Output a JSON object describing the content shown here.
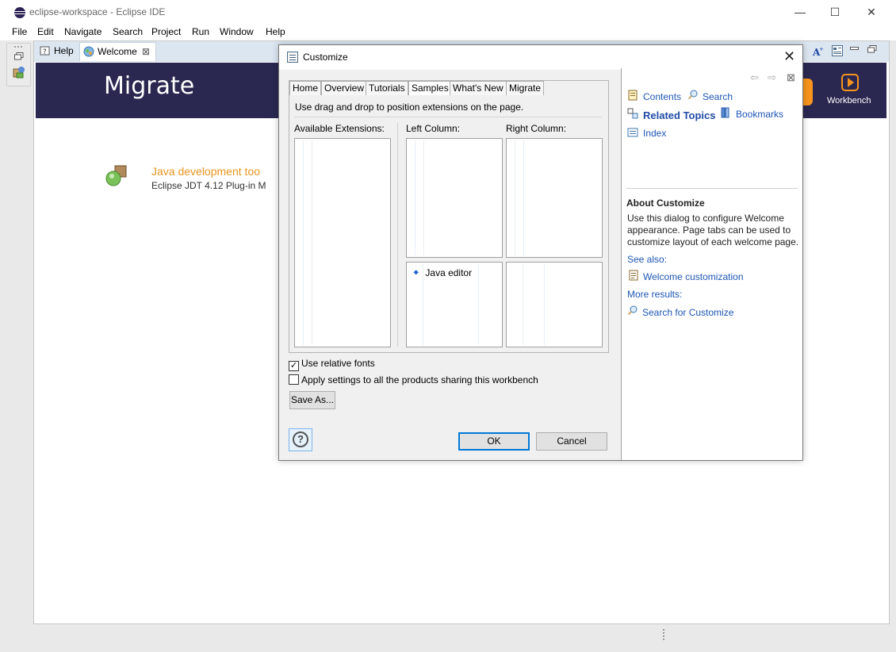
{
  "window": {
    "title": "eclipse-workspace - Eclipse IDE",
    "controls": {
      "minimize": "—",
      "maximize": "☐",
      "close": "✕"
    }
  },
  "menu": [
    "File",
    "Edit",
    "Navigate",
    "Search",
    "Project",
    "Run",
    "Window",
    "Help"
  ],
  "editor_tabs": [
    {
      "label": "Help",
      "icon": "help-icon"
    },
    {
      "label": "Welcome",
      "icon": "welcome-icon",
      "close": "⊠"
    }
  ],
  "welcome": {
    "banner_title": "Migrate",
    "workbench_label": "Workbench",
    "item_title": "Java development too",
    "item_desc": "Eclipse JDT 4.12 Plug-in M"
  },
  "dialog": {
    "title": "Customize",
    "close": "✕",
    "tabs": [
      "Home",
      "Overview",
      "Tutorials",
      "Samples",
      "What's New",
      "Migrate"
    ],
    "active_tab": "Samples",
    "hint": "Use drag and drop to position extensions on the page.",
    "columns": {
      "available": "Available Extensions:",
      "left": "Left Column:",
      "right": "Right Column:"
    },
    "left_lower_item": "Java editor",
    "checkbox_fonts": "Use relative fonts",
    "checkbox_fonts_checked": true,
    "checkbox_apply": "Apply settings to all the products sharing this workbench",
    "checkbox_apply_checked": false,
    "save_as": "Save As...",
    "ok": "OK",
    "cancel": "Cancel",
    "help_glyph": "?"
  },
  "help_pane": {
    "nav": {
      "back": "⇦",
      "forward": "⇨",
      "close": "⊠"
    },
    "links": {
      "contents": "Contents",
      "search": "Search",
      "related_topics": "Related Topics",
      "bookmarks": "Bookmarks",
      "index": "Index"
    },
    "about_title": "About Customize",
    "about_text": "Use this dialog to configure Welcome appearance. Page tabs can be used to customize layout of each welcome page.",
    "see_also": "See also:",
    "welcome_customization": "Welcome customization",
    "more_results": "More results:",
    "search_for": "Search for Customize"
  },
  "colors": {
    "banner": "#2a2850",
    "accent_orange": "#f7941d",
    "link": "#1d56b4",
    "tabstrip": "#dbe6f1"
  }
}
